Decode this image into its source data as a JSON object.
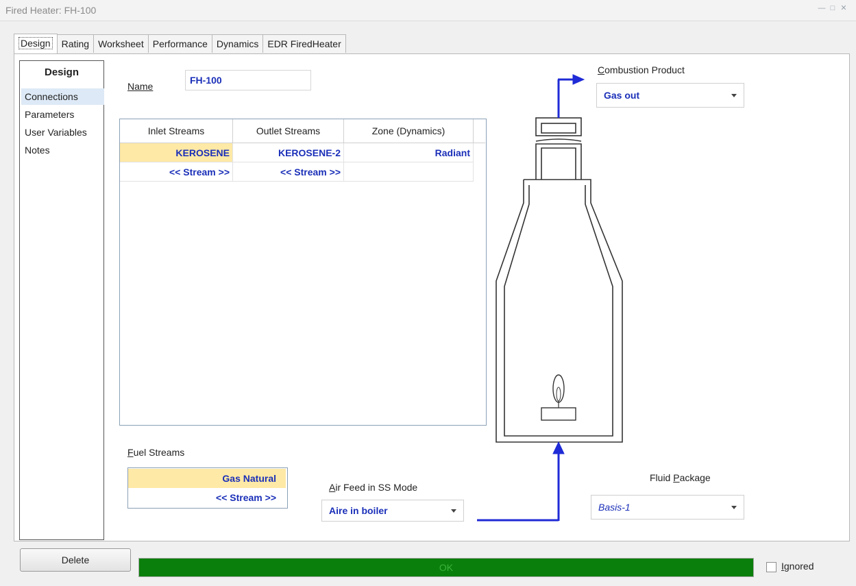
{
  "window": {
    "title": "Fired Heater: FH-100",
    "controls": [
      "minimize-icon",
      "restore-icon",
      "close-icon"
    ]
  },
  "tabs": [
    {
      "label": "Design",
      "active": true
    },
    {
      "label": "Rating",
      "active": false
    },
    {
      "label": "Worksheet",
      "active": false
    },
    {
      "label": "Performance",
      "active": false
    },
    {
      "label": "Dynamics",
      "active": false
    },
    {
      "label": "EDR FiredHeater",
      "active": false
    }
  ],
  "sidebar": {
    "title": "Design",
    "items": [
      {
        "label": "Connections",
        "selected": true
      },
      {
        "label": "Parameters",
        "selected": false
      },
      {
        "label": "User Variables",
        "selected": false
      },
      {
        "label": "Notes",
        "selected": false
      }
    ]
  },
  "name_field": {
    "label": "Name",
    "value": "FH-100"
  },
  "streams_table": {
    "headers": [
      "Inlet Streams",
      "Outlet Streams",
      "Zone (Dynamics)"
    ],
    "rows": [
      [
        "KEROSENE",
        "KEROSENE-2",
        "Radiant"
      ],
      [
        "<< Stream >>",
        "<< Stream >>",
        ""
      ]
    ]
  },
  "combustion_product": {
    "label": "Combustion Product",
    "value": "Gas out"
  },
  "fuel_streams": {
    "label": "Fuel Streams",
    "rows": [
      "Gas Natural",
      "<< Stream >>"
    ]
  },
  "air_feed": {
    "label": "Air Feed in SS Mode",
    "value": "Aire in boiler"
  },
  "fluid_package": {
    "label": "Fluid Package",
    "value": "Basis-1"
  },
  "footer": {
    "delete_label": "Delete",
    "status_text": "OK",
    "ignored_label": "Ignored",
    "ignored_checked": false
  },
  "colors": {
    "status_ok": "#0b7f0b",
    "value_text": "#1a2fb8",
    "highlight_cell": "#ffe9a6",
    "stream_arrow": "#1f2bd6"
  }
}
